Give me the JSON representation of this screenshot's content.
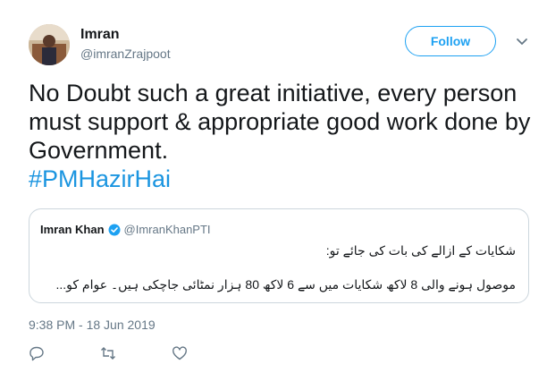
{
  "author": {
    "name": "Imran",
    "handle": "@imranZrajpoot",
    "avatar_icon": "profile-photo"
  },
  "follow_label": "Follow",
  "tweet": {
    "text": "No Doubt such a great initiative, every person must support & appropriate good work done by Government.",
    "hashtag": "#PMHazirHai"
  },
  "quoted": {
    "name": "Imran Khan",
    "handle": "@ImranKhanPTI",
    "line1": "شکایات کے ازالے کی بات کی جائے تو:",
    "line2": "موصول ہونے والی 8 لاکھ شکایات میں سے 6 لاکھ 80 ہزار نمٹائی جاچکی ہیں۔ عوام کو..."
  },
  "timestamp": "9:38 PM - 18 Jun 2019",
  "colors": {
    "accent": "#1da1f2",
    "hashtag": "#1b95e0",
    "secondary_text": "#657786",
    "border": "#ccd6dd"
  },
  "icons": [
    "reply-icon",
    "retweet-icon",
    "like-icon",
    "verified-icon",
    "chevron-down-icon"
  ]
}
